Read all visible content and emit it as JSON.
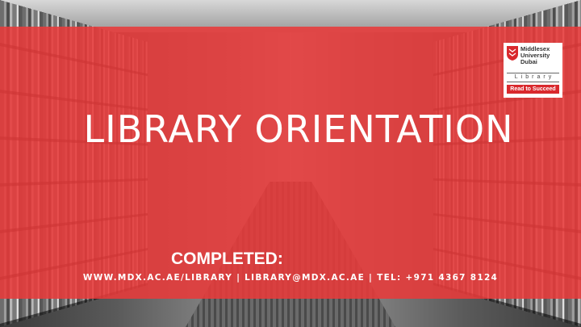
{
  "banner": {
    "title": "LIBRARY ORIENTATION",
    "completed_label": "COMPLETED:",
    "contact_line": "WWW.MDX.AC.AE/LIBRARY | LIBRARY@MDX.AC.AE | TEL: +971 4367 8124"
  },
  "logo": {
    "line1": "Middlesex",
    "line2": "University",
    "line3": "Dubai",
    "library": "Library",
    "tagline": "Read to Succeed"
  },
  "colors": {
    "band": "#e83a3a",
    "logo_accent": "#d9292d",
    "text": "#ffffff"
  }
}
